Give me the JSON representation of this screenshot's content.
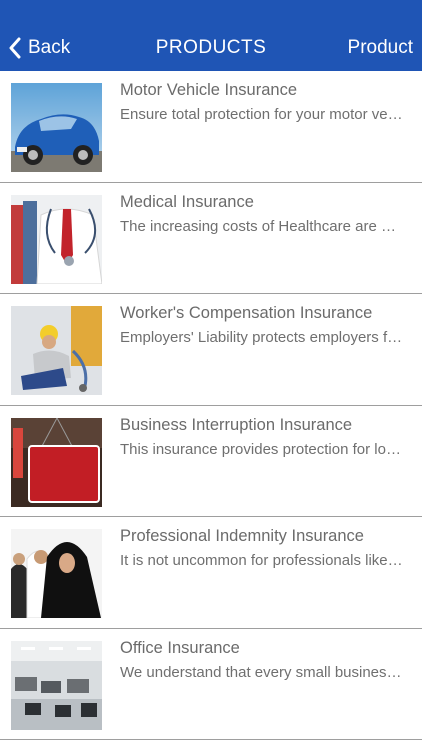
{
  "nav": {
    "back_label": "Back",
    "title": "PRODUCTS",
    "right_label": "Product",
    "bar_color": "#1f55b5"
  },
  "products": [
    {
      "title": "Motor Vehicle Insurance",
      "description": "Ensure total protection for your motor vehicle",
      "image": "blue-car-photo"
    },
    {
      "title": "Medical Insurance",
      "description": "The increasing costs of Healthcare are a concern",
      "image": "doctor-stethoscope-photo"
    },
    {
      "title": "Worker's Compensation Insurance",
      "description": "Employers' Liability protects employers from claims",
      "image": "injured-worker-photo"
    },
    {
      "title": "Business Interruption Insurance",
      "description": "This insurance provides protection for lost income",
      "image": "sorry-closed-sign-photo"
    },
    {
      "title": "Professional Indemnity Insurance",
      "description": "It is not uncommon for professionals like you",
      "image": "professionals-group-photo"
    },
    {
      "title": "Office Insurance",
      "description": "We understand that every small business owner",
      "image": "office-interior-photo"
    }
  ]
}
